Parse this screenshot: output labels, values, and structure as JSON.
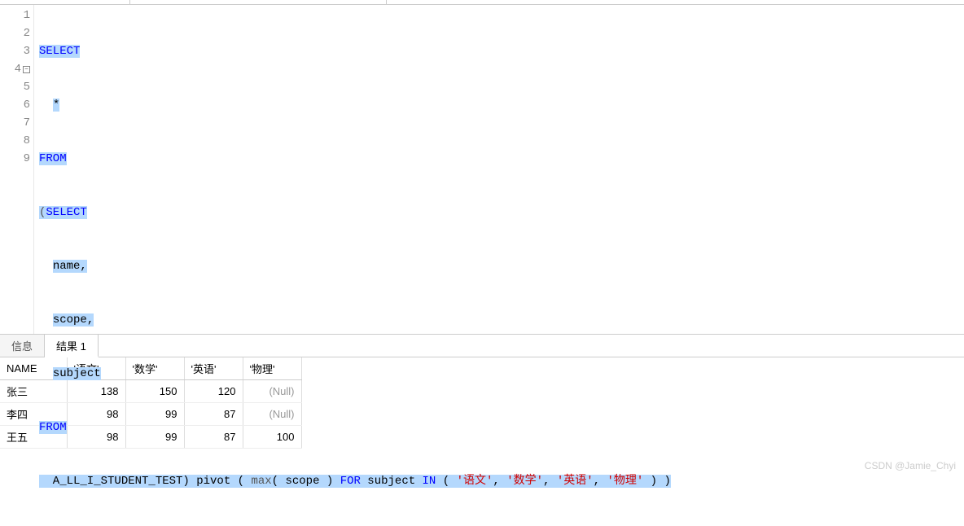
{
  "editor": {
    "lines": [
      {
        "num": "1",
        "fold": false
      },
      {
        "num": "2",
        "fold": false
      },
      {
        "num": "3",
        "fold": false
      },
      {
        "num": "4",
        "fold": true
      },
      {
        "num": "5",
        "fold": false
      },
      {
        "num": "6",
        "fold": false
      },
      {
        "num": "7",
        "fold": false
      },
      {
        "num": "8",
        "fold": false
      },
      {
        "num": "9",
        "fold": false
      }
    ],
    "tokens": {
      "select": "SELECT",
      "star": "*",
      "from": "FROM",
      "lparen_select": "(SELECT",
      "name": "name,",
      "scope": "scope,",
      "subject": "subject",
      "table_line": "  A_LL_I_STUDENT_TEST) pivot ( ",
      "max": "max",
      "max_args": "( scope ) ",
      "for": "FOR",
      "for_after": " subject ",
      "in": "IN",
      "in_open": " ( ",
      "s1": "'语文'",
      "comma": ", ",
      "s2": "'数学'",
      "s3": "'英语'",
      "s4": "'物理'",
      "in_close": " ) )"
    }
  },
  "tabs": {
    "info": "信息",
    "result1": "结果 1"
  },
  "table": {
    "headers": [
      "NAME",
      "'语文'",
      "'数学'",
      "'英语'",
      "'物理'"
    ],
    "rows": [
      {
        "name": "张三",
        "v": [
          "138",
          "150",
          "120",
          null
        ]
      },
      {
        "name": "李四",
        "v": [
          "98",
          "99",
          "87",
          null
        ]
      },
      {
        "name": "王五",
        "v": [
          "98",
          "99",
          "87",
          "100"
        ]
      }
    ],
    "null_text": "(Null)"
  },
  "watermark": "CSDN @Jamie_Chyi"
}
